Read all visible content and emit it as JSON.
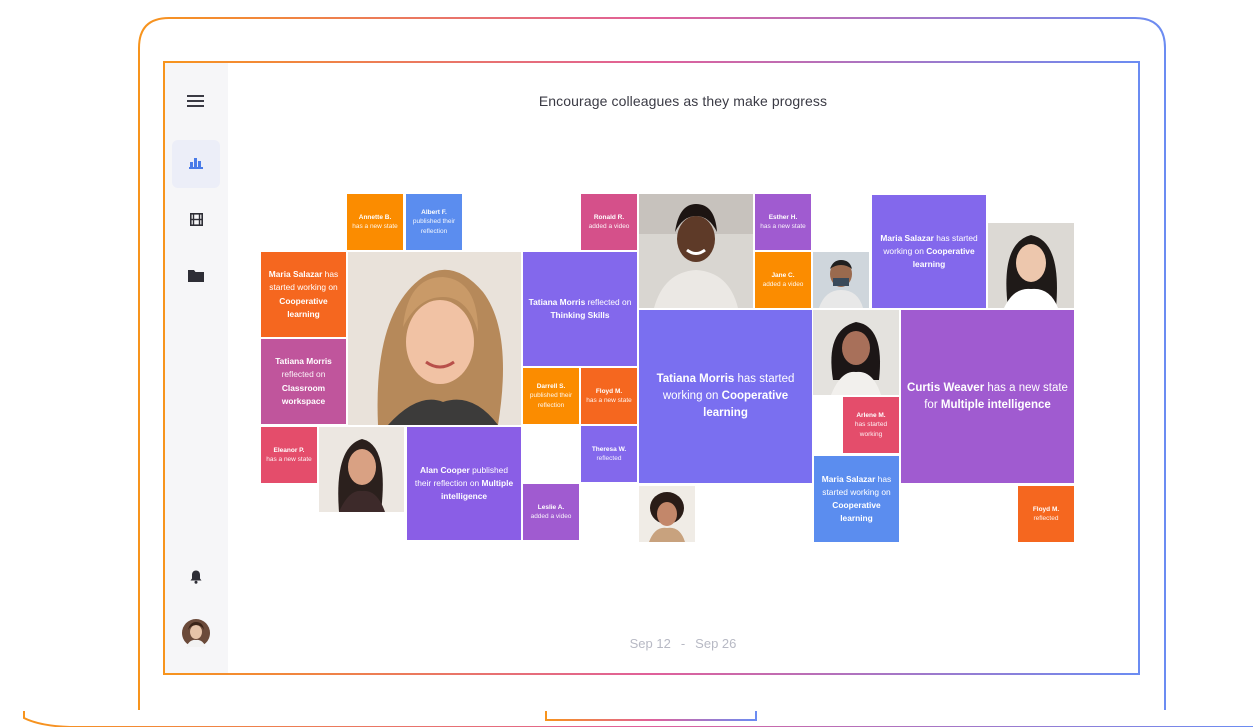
{
  "heading": "Encourage colleagues as they make progress",
  "date_range": {
    "start": "Sep 12",
    "separator": "-",
    "end": "Sep 26"
  },
  "sidebar": {
    "items": [
      {
        "icon": "menu-icon"
      },
      {
        "icon": "bar-chart-icon",
        "active": true
      },
      {
        "icon": "film-icon"
      },
      {
        "icon": "folder-icon"
      },
      {
        "icon": "bell-icon"
      },
      {
        "icon": "avatar"
      }
    ]
  },
  "colors": {
    "orange": "#f5671f",
    "amber": "#fb8c00",
    "blue": "#5b8def",
    "purple": "#8368ec",
    "violet": "#a05bd0",
    "magenta": "#c0559c",
    "pink": "#e44d6b",
    "indigo": "#6c7cf0"
  },
  "activity": {
    "annette": {
      "name": "Annette B.",
      "action": "has a new state"
    },
    "albert": {
      "name": "Albert F.",
      "action": "published their reflection"
    },
    "ronald": {
      "name": "Ronald R.",
      "action": "added a video"
    },
    "esther": {
      "name": "Esther H.",
      "action": "has a new state"
    },
    "jane": {
      "name": "Jane C.",
      "action": "added a video"
    },
    "maria1": {
      "name": "Maria Salazar",
      "pre": "has started working on",
      "topic": "Cooperative learning"
    },
    "maria2": {
      "name": "Maria Salazar",
      "pre": "has started working on",
      "topic": "Cooperative learning"
    },
    "maria3": {
      "name": "Maria Salazar",
      "pre": "has started working on",
      "topic": "Cooperative learning"
    },
    "tatiana1": {
      "name": "Tatiana Morris",
      "pre": "reflected on",
      "topic": "Thinking Skills"
    },
    "tatiana2": {
      "name": "Tatiana Morris",
      "pre": "reflected on",
      "topic": "Classroom workspace"
    },
    "tatiana3": {
      "name": "Tatiana Morris",
      "pre": "has started working on",
      "topic": "Cooperative learning"
    },
    "curtis": {
      "name": "Curtis Weaver",
      "pre": "has a new state for",
      "topic": "Multiple intelligence"
    },
    "darrell": {
      "name": "Darrell S.",
      "action": "published their reflection"
    },
    "floyd1": {
      "name": "Floyd M.",
      "action": "has a new state"
    },
    "theresa": {
      "name": "Theresa W.",
      "action": "reflected"
    },
    "arlene": {
      "name": "Arlene M.",
      "action": "has started working"
    },
    "eleanor": {
      "name": "Eleanor P.",
      "action": "has a new state"
    },
    "alan": {
      "name": "Alan Cooper",
      "pre": "published their reflection on",
      "topic": "Multiple intelligence"
    },
    "leslie": {
      "name": "Leslie A.",
      "action": "added a video"
    },
    "floyd2": {
      "name": "Floyd M.",
      "action": "reflected"
    }
  }
}
